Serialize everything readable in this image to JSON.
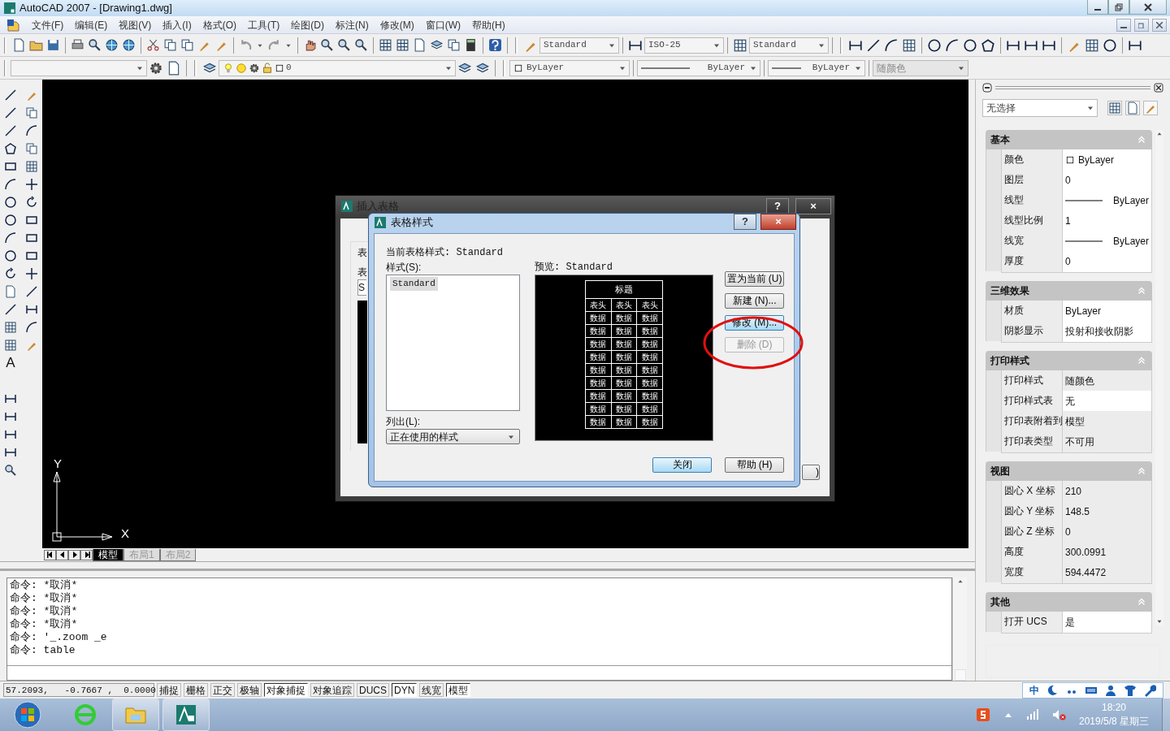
{
  "window": {
    "title": "AutoCAD 2007 - [Drawing1.dwg]"
  },
  "menu": [
    "文件(F)",
    "编辑(E)",
    "视图(V)",
    "插入(I)",
    "格式(O)",
    "工具(T)",
    "绘图(D)",
    "标注(N)",
    "修改(M)",
    "窗口(W)",
    "帮助(H)"
  ],
  "style_dropdowns": [
    {
      "value": "Standard"
    },
    {
      "value": "ISO-25"
    },
    {
      "value": "Standard"
    }
  ],
  "layer": {
    "name": "0"
  },
  "property_dropdowns": [
    {
      "kind": "color",
      "value": "ByLayer",
      "disabled": false
    },
    {
      "kind": "linetype",
      "value": "ByLayer",
      "disabled": false
    },
    {
      "kind": "linetype",
      "value": "ByLayer",
      "disabled": false
    },
    {
      "kind": "text",
      "value": "随颜色",
      "disabled": true
    }
  ],
  "draw_toolbar": {
    "text_tool": "A"
  },
  "drawing": {
    "x_axis": "X",
    "y_axis": "Y"
  },
  "layout_tabs": [
    {
      "label": "模型",
      "selected": true
    },
    {
      "label": "布局1",
      "selected": false
    },
    {
      "label": "布局2",
      "selected": false
    }
  ],
  "command_history": [
    "命令: *取消*",
    "命令: *取消*",
    "命令: *取消*",
    "命令: *取消*",
    "命令: '_.zoom _e",
    "命令: table"
  ],
  "status_bar": {
    "coordinates": "57.2093,   -0.7667 ,  0.0000",
    "toggles": [
      {
        "label": "捕捉",
        "on": false
      },
      {
        "label": "栅格",
        "on": false
      },
      {
        "label": "正交",
        "on": false
      },
      {
        "label": "极轴",
        "on": false
      },
      {
        "label": "对象捕捉",
        "on": true
      },
      {
        "label": "对象追踪",
        "on": false
      },
      {
        "label": "DUCS",
        "on": false
      },
      {
        "label": "DYN",
        "on": true
      },
      {
        "label": "线宽",
        "on": false
      },
      {
        "label": "模型",
        "on": true
      }
    ]
  },
  "ime_bar": {
    "mode": "中"
  },
  "properties": {
    "selection": "无选择",
    "sections": [
      {
        "title": "基本",
        "rows": [
          {
            "label": "颜色",
            "value": "ByLayer",
            "kind": "color",
            "disabled": false
          },
          {
            "label": "图层",
            "value": "0",
            "kind": "text",
            "disabled": false
          },
          {
            "label": "线型",
            "value": "ByLayer",
            "kind": "linetype",
            "disabled": false
          },
          {
            "label": "线型比例",
            "value": "1",
            "kind": "text",
            "disabled": false
          },
          {
            "label": "线宽",
            "value": "ByLayer",
            "kind": "linetype",
            "disabled": false
          },
          {
            "label": "厚度",
            "value": "0",
            "kind": "text",
            "disabled": false
          }
        ]
      },
      {
        "title": "三维效果",
        "rows": [
          {
            "label": "材质",
            "value": "ByLayer",
            "kind": "text",
            "disabled": false
          },
          {
            "label": "阴影显示",
            "value": "投射和接收阴影",
            "kind": "text",
            "disabled": false
          }
        ]
      },
      {
        "title": "打印样式",
        "rows": [
          {
            "label": "打印样式",
            "value": "随颜色",
            "kind": "text",
            "disabled": true
          },
          {
            "label": "打印样式表",
            "value": "无",
            "kind": "text",
            "disabled": false
          },
          {
            "label": "打印表附着到",
            "value": "模型",
            "kind": "text",
            "disabled": true
          },
          {
            "label": "打印表类型",
            "value": "不可用",
            "kind": "text",
            "disabled": true
          }
        ]
      },
      {
        "title": "视图",
        "rows": [
          {
            "label": "圆心 X 坐标",
            "value": "210",
            "kind": "text",
            "disabled": true
          },
          {
            "label": "圆心 Y 坐标",
            "value": "148.5",
            "kind": "text",
            "disabled": true
          },
          {
            "label": "圆心 Z 坐标",
            "value": "0",
            "kind": "text",
            "disabled": true
          },
          {
            "label": "高度",
            "value": "300.0991",
            "kind": "text",
            "disabled": true
          },
          {
            "label": "宽度",
            "value": "594.4472",
            "kind": "text",
            "disabled": true
          }
        ]
      },
      {
        "title": "其他",
        "rows": [
          {
            "label": "打开 UCS",
            "value": "是",
            "kind": "text",
            "disabled": false
          }
        ]
      }
    ]
  },
  "insert_table_dialog": {
    "title": "插入表格",
    "help_button": "?",
    "close_button": "×",
    "labels": [
      "表",
      "表"
    ],
    "field": "S",
    "button": ")"
  },
  "table_style_dialog": {
    "title": "表格样式",
    "help_button": "?",
    "close_button": "×",
    "current_style": "当前表格样式: Standard",
    "styles_label": "样式(S):",
    "styles": [
      {
        "name": "Standard",
        "selected": true
      }
    ],
    "list_label": "列出(L):",
    "list_value": "正在使用的样式",
    "preview_label": "预览: Standard",
    "preview": {
      "title": "标题",
      "header": [
        "表头",
        "表头",
        "表头"
      ],
      "rows": [
        [
          "数据",
          "数据",
          "数据"
        ],
        [
          "数据",
          "数据",
          "数据"
        ],
        [
          "数据",
          "数据",
          "数据"
        ],
        [
          "数据",
          "数据",
          "数据"
        ],
        [
          "数据",
          "数据",
          "数据"
        ],
        [
          "数据",
          "数据",
          "数据"
        ],
        [
          "数据",
          "数据",
          "数据"
        ],
        [
          "数据",
          "数据",
          "数据"
        ],
        [
          "数据",
          "数据",
          "数据"
        ]
      ]
    },
    "side_buttons": [
      {
        "label": "置为当前 (U)",
        "disabled": false,
        "focused": false
      },
      {
        "label": "新建 (N)...",
        "disabled": false,
        "focused": false
      },
      {
        "label": "修改 (M)...",
        "disabled": false,
        "focused": true
      },
      {
        "label": "删除 (D)",
        "disabled": true,
        "focused": false
      }
    ],
    "bottom_buttons": [
      {
        "label": "关闭",
        "disabled": false,
        "focused": true
      },
      {
        "label": "帮助 (H)",
        "disabled": false,
        "focused": false
      }
    ]
  },
  "taskbar": {
    "apps": [
      {
        "kind": "browser",
        "running": false
      },
      {
        "kind": "explorer",
        "running": true
      },
      {
        "kind": "cad",
        "running": true
      }
    ],
    "time": "18:20",
    "date": "2019/5/8 星期三"
  }
}
